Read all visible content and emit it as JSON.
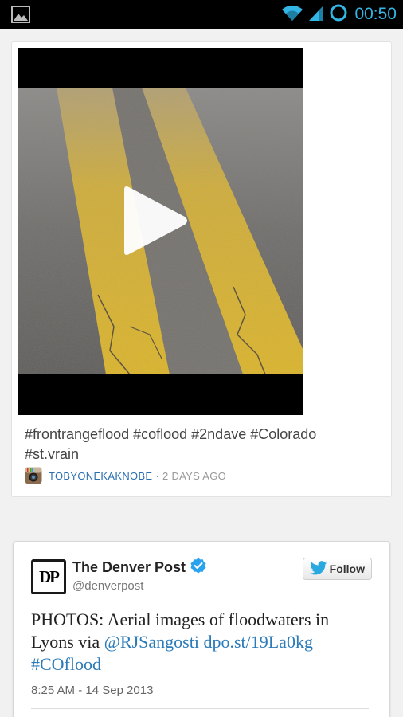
{
  "status_bar": {
    "time": "00:50",
    "notification_icon": "image-icon",
    "wifi_icon": "wifi-icon",
    "signal_icon": "signal-icon",
    "sync_icon": "circle-icon",
    "accent_color": "#33b5e5"
  },
  "instagram_post": {
    "caption_line1": "#frontrangeflood #coflood #2ndave #Colorado",
    "caption_line2": "#st.vrain",
    "author": "TOBYONEKAKNOBE",
    "separator": "·",
    "time_ago": "2 DAYS AGO",
    "play_icon": "play-icon"
  },
  "tweet": {
    "logo_text": "DP",
    "account_name": "The Denver Post",
    "handle": "@denverpost",
    "follow_label": "Follow",
    "text_plain": "PHOTOS: Aerial images of floodwaters in Lyons via ",
    "text_mention": "@RJSangosti",
    "text_link": "dpo.st/19La0kg",
    "text_space": " ",
    "text_hashtag": "#COflood",
    "timestamp": "8:25 AM - 14 Sep 2013",
    "link_color": "#2b7bb9",
    "verified_color": "#2aa3ef",
    "twitter_color": "#2aa9e0"
  }
}
